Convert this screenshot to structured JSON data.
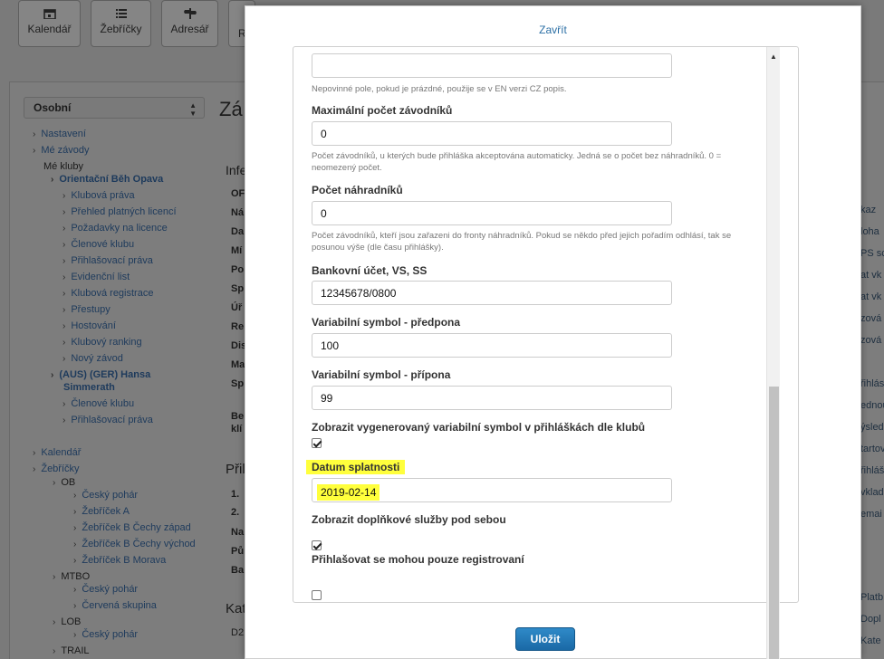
{
  "background": {
    "tabs": [
      {
        "label": "Kalendář",
        "icon": "calendar-icon"
      },
      {
        "label": "Žebříčky",
        "icon": "list-icon"
      },
      {
        "label": "Adresář",
        "icon": "signpost-icon"
      },
      {
        "label": "R",
        "icon": ""
      }
    ],
    "profile_select": "Osobní",
    "heading_partial": "Zá",
    "tree": [
      "Nastavení",
      "Mé závody",
      "Mé kluby",
      "Orientační Běh Opava",
      "Klubová práva",
      "Přehled platných licencí",
      "Požadavky na licence",
      "Členové klubu",
      "Přihlašovací práva",
      "Evidenční list",
      "Klubová registrace",
      "Přestupy",
      "Hostování",
      "Klubový ranking",
      "Nový závod",
      "(AUS) (GER) Hansa",
      "Simmerath",
      "Členové klubu",
      "Přihlašovací práva",
      "Kalendář",
      "Žebříčky",
      "OB",
      "Český pohár",
      "Žebříček A",
      "Žebříček B Čechy západ",
      "Žebříček B Čechy východ",
      "Žebříček B Morava",
      "MTBO",
      "Český pohár",
      "Červená skupina",
      "LOB",
      "Český pohár",
      "TRAIL"
    ],
    "mid_labels": [
      "Infe",
      "OF",
      "Ná",
      "Da",
      "Mí",
      "Po",
      "Sp",
      "Úř",
      "Re",
      "Dis",
      "Ma",
      "Sp",
      "Be",
      "klí",
      "Přil",
      "1.",
      "2.",
      "Na",
      "Pů",
      "Ba",
      "Kat",
      "D2"
    ],
    "right_labels": [
      "kaz",
      "loha",
      "PS sc",
      "at vk",
      "at vk",
      "zová",
      "zová",
      "řihlás",
      "ednou",
      "ýsled",
      "tartov",
      "řihláš",
      "vklad",
      "emai",
      "Platb",
      "Dopl",
      "Kate",
      "Lim"
    ]
  },
  "modal": {
    "close_label": "Zavřít",
    "top_hint": "Nepovinné pole, pokud je prázdné, použije se v EN verzi CZ popis.",
    "fields": {
      "max_competitors": {
        "label": "Maximální počet závodníků",
        "value": "0",
        "hint": "Počet závodníků, u kterých bude přihláška akceptována automaticky. Jedná se o počet bez náhradníků. 0 = neomezený počet."
      },
      "substitutes": {
        "label": "Počet náhradníků",
        "value": "0",
        "hint": "Počet závodníků, kteří jsou zařazeni do fronty náhradníků. Pokud se někdo před jejich pořadím odhlásí, tak se posunou výše (dle času přihlášky)."
      },
      "bank_account": {
        "label": "Bankovní účet, VS, SS",
        "value": "12345678/0800"
      },
      "vs_prefix": {
        "label": "Variabilní symbol - předpona",
        "value": "100"
      },
      "vs_suffix": {
        "label": "Variabilní symbol - přípona",
        "value": "99"
      },
      "show_vs": {
        "label": "Zobrazit vygenerovaný variabilní symbol v přihláškách dle klubů",
        "checked": true
      },
      "due_date": {
        "label": "Datum splatnosti",
        "value": "2019-02-14"
      },
      "show_extras": {
        "label": "Zobrazit doplňkové služby pod sebou",
        "checked": true
      },
      "registered_only": {
        "label": "Přihlašovat se mohou pouze registrovaní",
        "checked": false
      }
    },
    "save_label": "Uložit",
    "highlight_color": "#ffff3c",
    "accent_color": "#2b6fa5"
  }
}
